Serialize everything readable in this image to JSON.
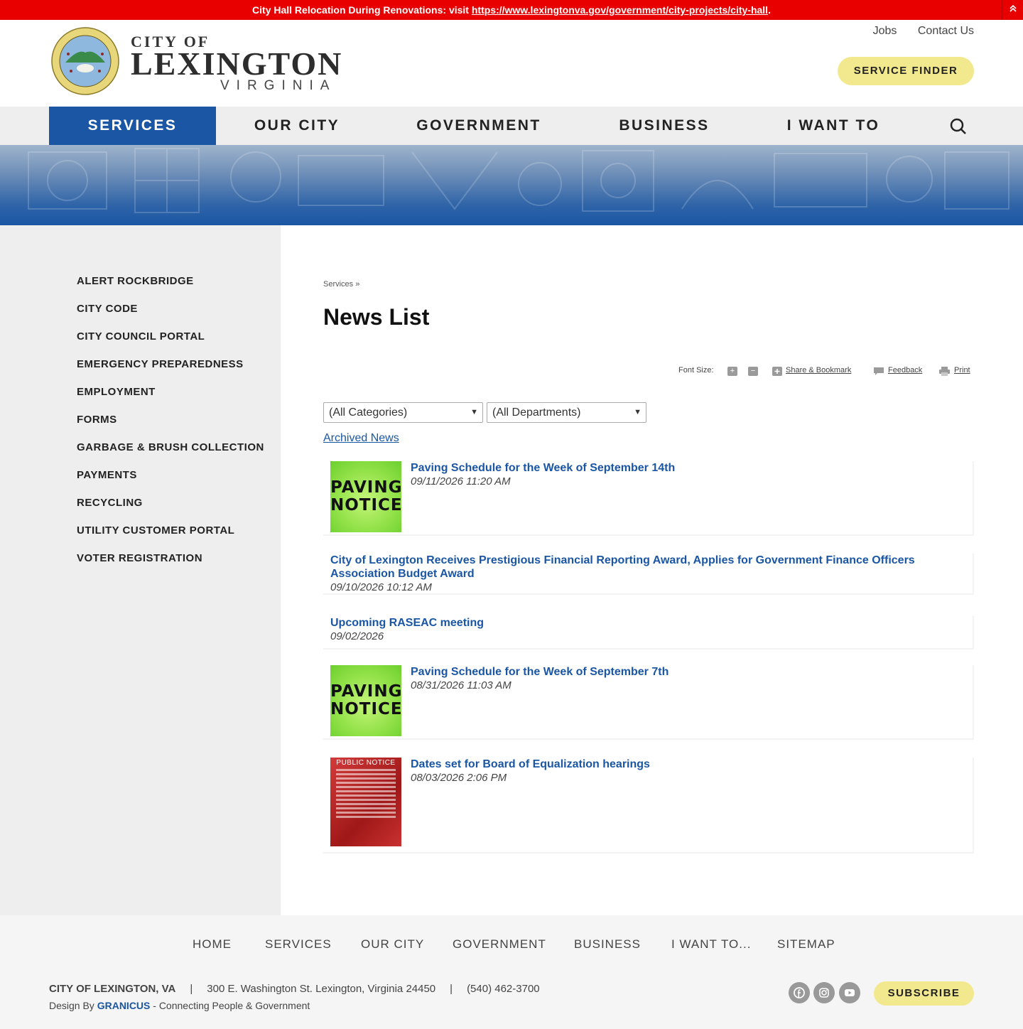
{
  "alert": {
    "text": "City Hall Relocation During Renovations: visit ",
    "link": "https://www.lexingtonva.gov/government/city-projects/city-hall",
    "suffix": ".",
    "collapse_icon": "double-chevron-up-icon"
  },
  "header": {
    "logo_line1": "CITY OF",
    "logo_line2": "LEXINGTON",
    "logo_line3": "VIRGINIA",
    "top_links": [
      "Jobs",
      "Contact Us"
    ],
    "service_finder": "SERVICE FINDER"
  },
  "nav": {
    "items": [
      "SERVICES",
      "OUR CITY",
      "GOVERNMENT",
      "BUSINESS",
      "I WANT TO"
    ],
    "active": "SERVICES",
    "search_icon": "search-icon"
  },
  "sidebar": {
    "items": [
      "ALERT ROCKBRIDGE",
      "CITY CODE",
      "CITY COUNCIL PORTAL",
      "EMERGENCY PREPAREDNESS",
      "EMPLOYMENT",
      "FORMS",
      "GARBAGE & BRUSH COLLECTION",
      "PAYMENTS",
      "RECYCLING",
      "UTILITY CUSTOMER PORTAL",
      "VOTER REGISTRATION"
    ]
  },
  "main": {
    "breadcrumb": "Services »",
    "title": "News List",
    "tools": {
      "font_size_label": "Font Size:",
      "plus": "+",
      "minus": "−",
      "share": "Share & Bookmark",
      "feedback": "Feedback",
      "print": "Print"
    },
    "filters": {
      "category": "(All Categories)",
      "department": "(All Departments)"
    },
    "archived_link": "Archived News",
    "news": [
      {
        "title": "Paving Schedule for the Week of September 14th",
        "date": "09/11/2026 11:20 AM",
        "thumb": "paving"
      },
      {
        "title_line1": "City of Lexington Receives Prestigious Financial Reporting Award, Applies for Government Finance Officers",
        "title_line2": "Association Budget Award",
        "date": "09/10/2026 10:12 AM"
      },
      {
        "title": "Upcoming RASEAC meeting",
        "date": "09/02/2026"
      },
      {
        "title": "Paving Schedule for the Week of September 7th",
        "date": "08/31/2026 11:03 AM",
        "thumb": "paving"
      },
      {
        "title": "Dates set for Board of Equalization hearings",
        "date": "08/03/2026 2:06 PM",
        "thumb": "public-notice"
      }
    ],
    "paving_line1": "PAVING",
    "paving_line2": "NOTICE",
    "public_notice_header": "PUBLIC NOTICE"
  },
  "footer": {
    "nav": [
      "HOME",
      "SERVICES",
      "OUR CITY",
      "GOVERNMENT",
      "BUSINESS",
      "I WANT TO...",
      "SITEMAP"
    ],
    "org": "CITY OF LEXINGTON, VA",
    "sep": "|",
    "address": "300 E. Washington St. Lexington, Virginia 24450",
    "phone": "(540) 462-3700",
    "design_by": "Design By ",
    "granicus": "GRANICUS",
    "tagline": " - Connecting People & Government",
    "social_icons": [
      "facebook-icon",
      "instagram-icon",
      "youtube-icon"
    ],
    "subscribe": "SUBSCRIBE"
  },
  "colors": {
    "alert": "#e80000",
    "brand_blue": "#1a56a4",
    "accent_yellow": "#f2e98e",
    "sidebar_bg": "#eeeeee"
  }
}
